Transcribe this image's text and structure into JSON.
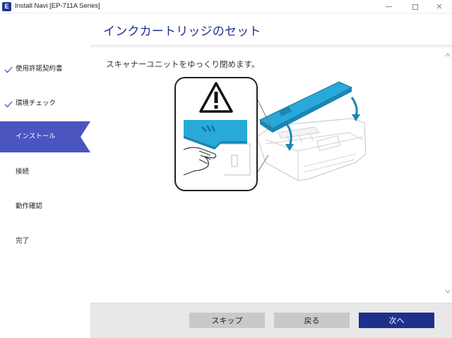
{
  "window": {
    "app_icon_letter": "E",
    "title": "Install Navi [EP-711A Series]",
    "minimize": "minimize",
    "maximize": "maximize",
    "close": "✕"
  },
  "sidebar": {
    "items": [
      {
        "label": "使用許諾契約書",
        "state": "done"
      },
      {
        "label": "環境チェック",
        "state": "done"
      },
      {
        "label": "インストール",
        "state": "active"
      },
      {
        "label": "接続",
        "state": "pending"
      },
      {
        "label": "動作確認",
        "state": "pending"
      },
      {
        "label": "完了",
        "state": "pending"
      }
    ]
  },
  "header": {
    "title": "インクカートリッジのセット"
  },
  "main": {
    "instruction": "スキャナーユニットをゆっくり閉めます。",
    "illustration_icons": [
      "warning-icon",
      "hand-icon",
      "printer-icon",
      "down-arrow-icon"
    ]
  },
  "footer": {
    "skip_label": "スキップ",
    "back_label": "戻る",
    "next_label": "次へ"
  },
  "colors": {
    "accent": "#1f2f8c",
    "sidebar_active": "#4a55c0",
    "check": "#4a55c0",
    "scanner_lid": "#29a9d9",
    "footer_bg": "#e8e8e8",
    "button_gray": "#c9c9c9"
  }
}
